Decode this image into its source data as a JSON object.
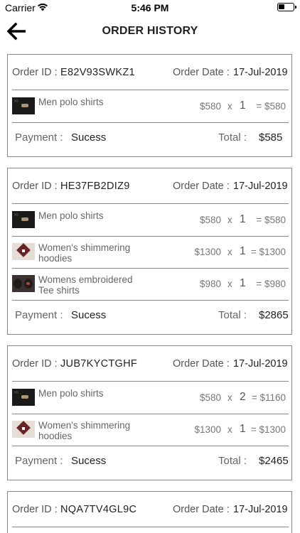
{
  "status_bar": {
    "carrier": "Carrier",
    "time": "5:46 PM"
  },
  "nav": {
    "title": "ORDER HISTORY"
  },
  "labels": {
    "order_id": "Order ID :",
    "order_date": "Order Date :",
    "payment": "Payment :",
    "total": "Total :",
    "times": "x",
    "equals": "="
  },
  "orders": [
    {
      "id": "E82V93SWKZ1",
      "date": "17-Jul-2019",
      "items": [
        {
          "name": "Men polo shirts",
          "price": "$580",
          "qty": "1",
          "total": "= $580",
          "thumb": "polo-shirt-thumbnail"
        }
      ],
      "payment": "Sucess",
      "total": "$585"
    },
    {
      "id": "HE37FB2DIZ9",
      "date": "17-Jul-2019",
      "items": [
        {
          "name": "Men polo shirts",
          "price": "$580",
          "qty": "1",
          "total": "= $580",
          "thumb": "polo-shirt-thumbnail"
        },
        {
          "name": "Women's shimmering hoodies",
          "price": "$1300",
          "qty": "1",
          "total": "= $1300",
          "thumb": "hoodie-thumbnail"
        },
        {
          "name": "Womens embroidered Tee shirts",
          "price": "$980",
          "qty": "1",
          "total": "= $980",
          "thumb": "tee-shirt-thumbnail"
        }
      ],
      "payment": "Sucess",
      "total": "$2865"
    },
    {
      "id": "JUB7KYCTGHF",
      "date": "17-Jul-2019",
      "items": [
        {
          "name": "Men polo shirts",
          "price": "$580",
          "qty": "2",
          "total": "= $1160",
          "thumb": "polo-shirt-thumbnail"
        },
        {
          "name": "Women's shimmering hoodies",
          "price": "$1300",
          "qty": "1",
          "total": "= $1300",
          "thumb": "hoodie-thumbnail"
        }
      ],
      "payment": "Sucess",
      "total": "$2465"
    },
    {
      "id": "NQA7TV4GL9C",
      "date": "17-Jul-2019",
      "items": [],
      "payment": "",
      "total": ""
    }
  ]
}
